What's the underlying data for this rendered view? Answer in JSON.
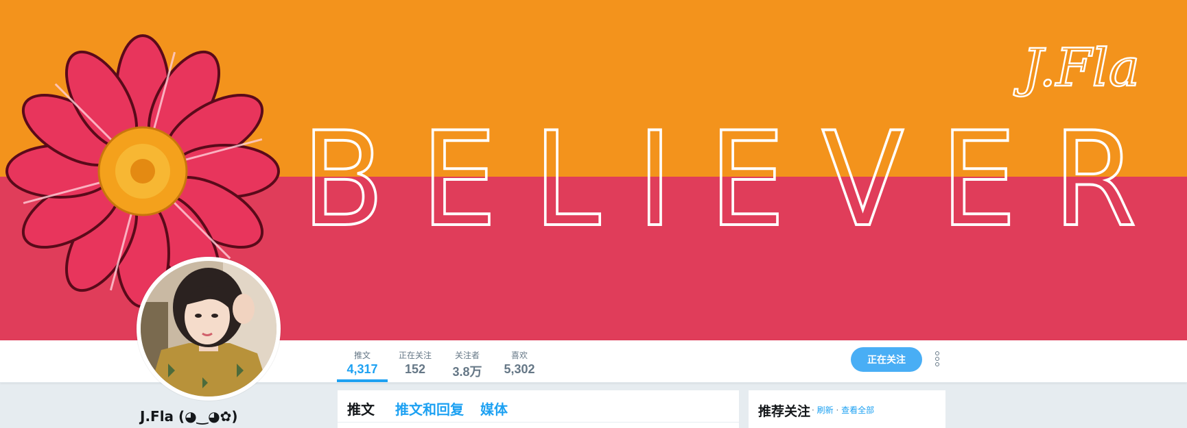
{
  "banner": {
    "word": "BELIEVER",
    "signature": "J.Fla",
    "colors": {
      "top": "#f3931c",
      "bottom": "#e03d5a",
      "petal": "#e8355c",
      "center": "#f4a11c"
    }
  },
  "nav": {
    "stats": [
      {
        "label": "推文",
        "value": "4,317"
      },
      {
        "label": "正在关注",
        "value": "152"
      },
      {
        "label": "关注者",
        "value": "3.8万"
      },
      {
        "label": "喜欢",
        "value": "5,302"
      }
    ],
    "follow_button": "正在关注"
  },
  "profile": {
    "name": "J.Fla (◕‿◕✿)"
  },
  "timeline": {
    "tabs": [
      "推文",
      "推文和回复",
      "媒体"
    ]
  },
  "who_to_follow": {
    "title": "推荐关注",
    "separator": "·",
    "refresh": "刷新",
    "view_all": "查看全部"
  },
  "accent": "#1da1f2"
}
